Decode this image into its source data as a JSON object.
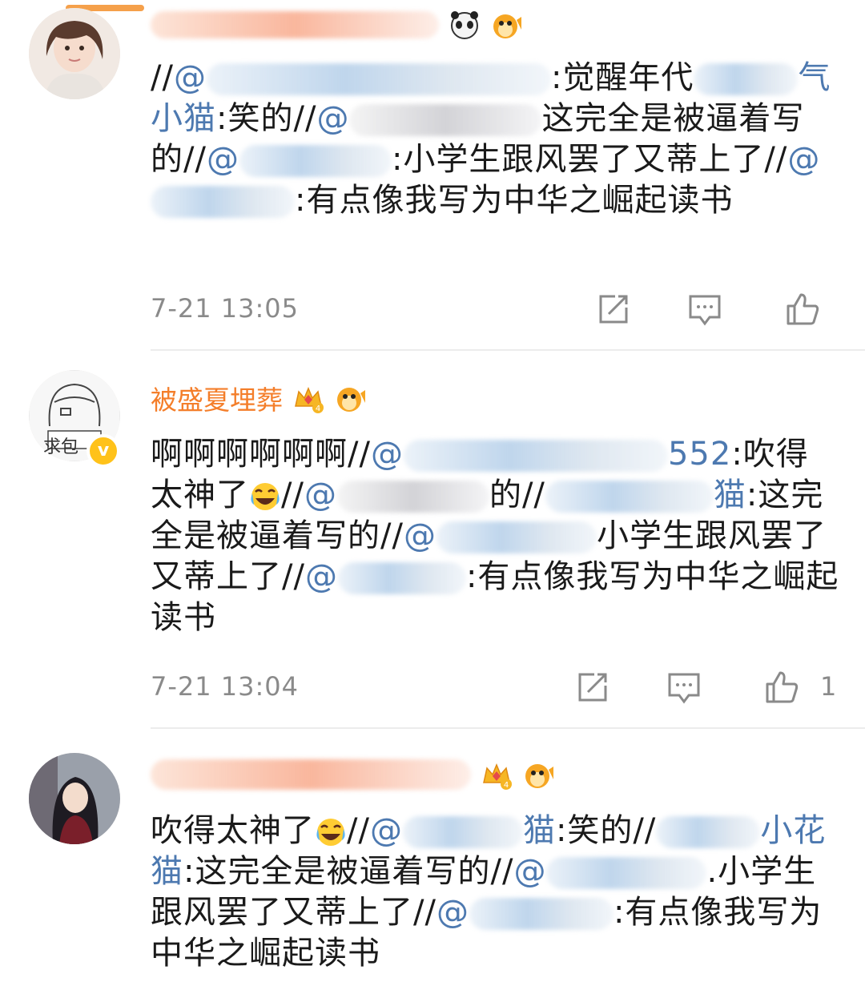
{
  "comments": [
    {
      "username": "",
      "time": "7-21 13:05",
      "like_count": "",
      "text": {
        "s1": "//",
        "m1": "@",
        "s2": ":觉醒年代",
        "m2a": "气小猫",
        "s3": ":笑的//",
        "m3": "@",
        "s4": "这完全是被逼着写的//",
        "m4": "@",
        "s5": ":小学生跟风罢了又蒂上了//",
        "m5": "@",
        "s6": ":有点像我写为中华之崛起读书"
      }
    },
    {
      "username": "被盛夏埋葬",
      "avatar_text": "求包",
      "verified_mark": "v",
      "time": "7-21 13:04",
      "like_count": "1",
      "text": {
        "s1": "啊啊啊啊啊啊//",
        "m1": "@",
        "m1b": "552",
        "s2": ":吹得太神了",
        "s3": "//",
        "m2": "@",
        "s4": "的//",
        "m3": "猫",
        "s5": ":这完全是被逼着写的//",
        "m4": "@",
        "s6": "小学生跟风罢了又蒂上了//",
        "m5": "@",
        "s7": ":有点像我写为中华之崛起读书"
      }
    },
    {
      "username": "",
      "time": "",
      "like_count": "",
      "text": {
        "s1": "吹得太神了",
        "s2": "//",
        "m1": "@",
        "m1b": "猫",
        "s3": ":笑的//",
        "m2": "小",
        "m2b": "花猫",
        "s4": ":这完全是被逼着写的//",
        "m3": "@",
        "s5": ".小学生跟风罢了又蒂上了//",
        "m4": "@",
        "s6": ":有点像我写为中华之崛起读书"
      }
    }
  ],
  "icons": [
    "repost-icon",
    "comment-icon",
    "like-icon",
    "emoji-laugh-cry-icon",
    "crown-level4-icon",
    "pufferfish-icon",
    "panda-icon"
  ],
  "colors": {
    "username": "#f47e2a",
    "mention": "#4d79b0",
    "meta": "#8a8a8a",
    "divider": "#ececec",
    "verified": "#ffc21a"
  }
}
